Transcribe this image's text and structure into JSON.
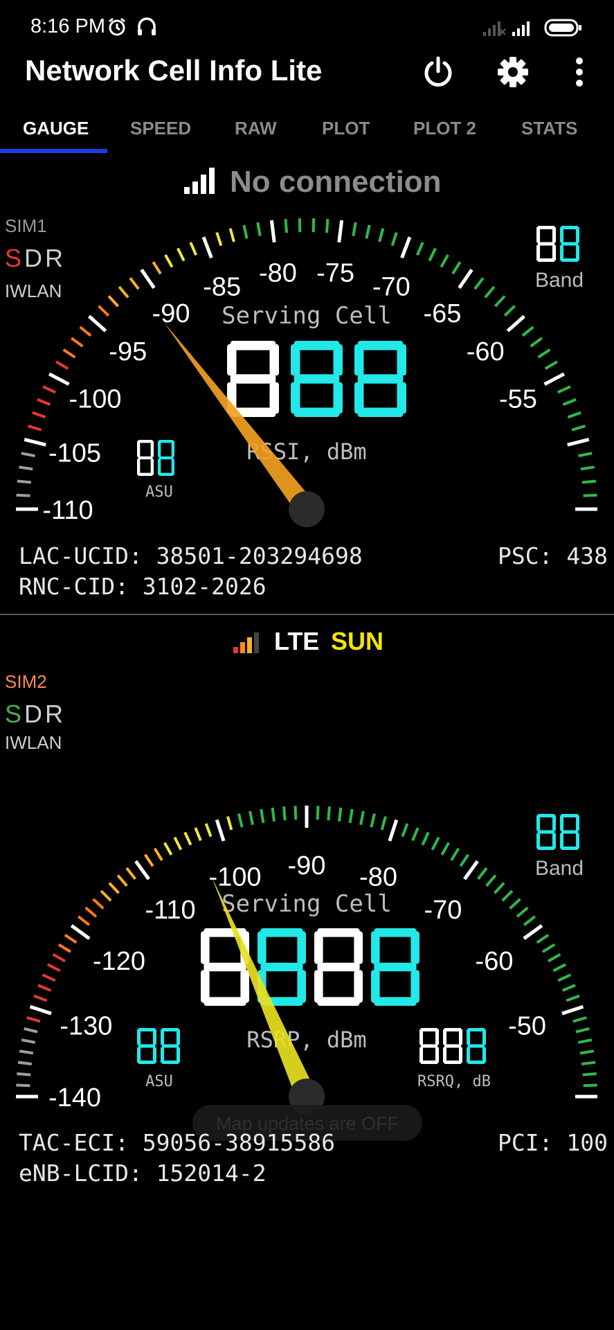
{
  "status_bar": {
    "time": "8:16 PM",
    "icons": [
      "alarm-icon",
      "headset-icon",
      "signal-sim1-icon",
      "signal-sim2-icon",
      "battery-icon"
    ]
  },
  "app_bar": {
    "title": "Network Cell Info Lite",
    "actions": [
      "power-icon",
      "settings-icon",
      "more-vert-icon"
    ]
  },
  "tabs": [
    {
      "label": "GAUGE",
      "active": true
    },
    {
      "label": "SPEED",
      "active": false
    },
    {
      "label": "RAW",
      "active": false
    },
    {
      "label": "PLOT",
      "active": false
    },
    {
      "label": "PLOT 2",
      "active": false
    },
    {
      "label": "STATS",
      "active": false
    }
  ],
  "sim1": {
    "connection": "No connection",
    "sim_label": "SIM1",
    "sdr": {
      "s": "S",
      "d": "D",
      "r": "R"
    },
    "iwlan": "IWLAN",
    "band_digits": "88",
    "band_label": "Band",
    "serving_cell": "Serving Cell",
    "main_digits": "888",
    "unit": "RSSI, dBm",
    "asu_digits": "88",
    "asu_label": "ASU",
    "ticks": [
      "-110",
      "-105",
      "-100",
      "-95",
      "-90",
      "-85",
      "-80",
      "-75",
      "-70",
      "-65",
      "-60",
      "-55"
    ],
    "needle_value": -96,
    "info": {
      "lac_ucid": "LAC-UCID: 38501-203294698",
      "rnc_cid": "RNC-CID: 3102-2026",
      "psc": "PSC: 438"
    },
    "colors": {
      "s": "#e53935",
      "needle": "#f0a020"
    }
  },
  "sim2": {
    "network": "LTE",
    "operator": "SUN",
    "sim_label": "SIM2",
    "sdr": {
      "s": "S",
      "d": "D",
      "r": "R"
    },
    "iwlan": "IWLAN",
    "band_digits": "88",
    "band_label": "Band",
    "serving_cell": "Serving Cell",
    "main_digits": "8888",
    "unit": "RSRP, dBm",
    "asu_digits": "88",
    "asu_label": "ASU",
    "rsrq_digits": "888",
    "rsrq_label": "RSRQ, dB",
    "ticks": [
      "-140",
      "-130",
      "-120",
      "-110",
      "-100",
      "-90",
      "-80",
      "-70",
      "-60",
      "-50"
    ],
    "needle_value": -108,
    "info": {
      "tac_eci": "TAC-ECI: 59056-38915586",
      "enb_lcid": "eNB-LCID: 152014-2",
      "pci": "PCI: 100"
    },
    "toast": "Map updates are OFF",
    "colors": {
      "s": "#4caf50",
      "operator": "#f5e400",
      "needle": "#e8e020",
      "sim_label": "#ff8a50"
    }
  },
  "digit_colors": {
    "active": "#22e8e8",
    "white": "#ffffff"
  }
}
